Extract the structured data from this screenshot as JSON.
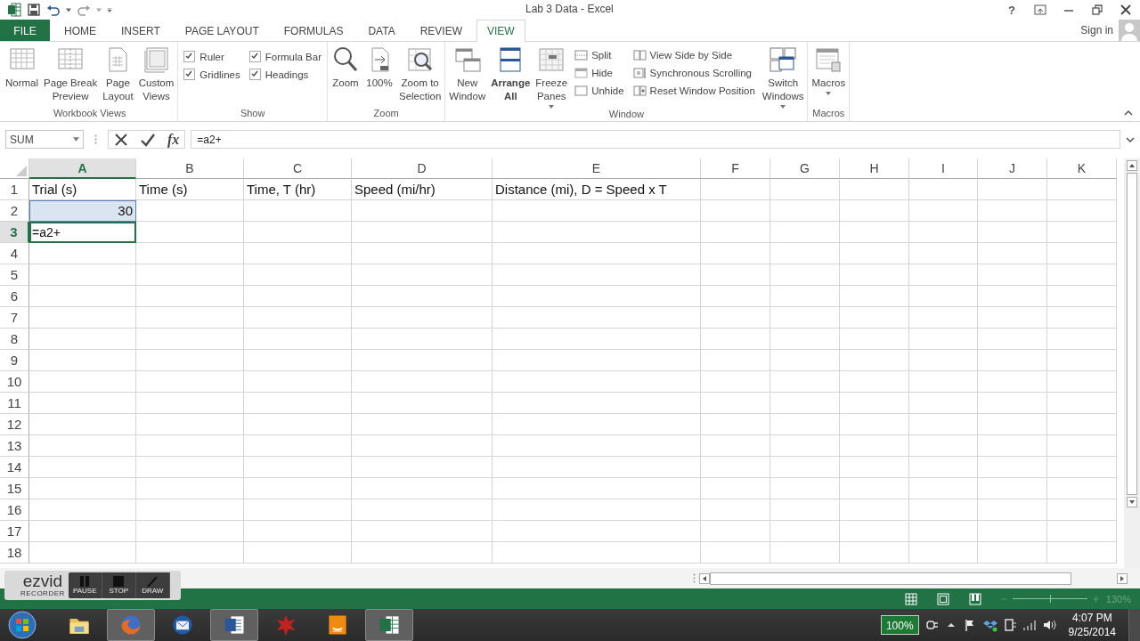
{
  "title_bar": {
    "title": "Lab 3 Data - Excel",
    "help": "?"
  },
  "tabs": [
    {
      "label": "FILE",
      "kind": "file",
      "selected": false
    },
    {
      "label": "HOME",
      "kind": "tab",
      "selected": false
    },
    {
      "label": "INSERT",
      "kind": "tab",
      "selected": false
    },
    {
      "label": "PAGE LAYOUT",
      "kind": "tab",
      "selected": false
    },
    {
      "label": "FORMULAS",
      "kind": "tab",
      "selected": false
    },
    {
      "label": "DATA",
      "kind": "tab",
      "selected": false
    },
    {
      "label": "REVIEW",
      "kind": "tab",
      "selected": false
    },
    {
      "label": "VIEW",
      "kind": "tab",
      "selected": true
    }
  ],
  "account": {
    "label": "Sign in"
  },
  "ribbon": {
    "groups": [
      {
        "label": "Workbook Views",
        "items": [
          {
            "kind": "large",
            "label": "Normal"
          },
          {
            "kind": "large",
            "label": "Page Break\nPreview"
          },
          {
            "kind": "large",
            "label": "Page\nLayout"
          },
          {
            "kind": "large",
            "label": "Custom\nViews"
          }
        ]
      },
      {
        "label": "Show",
        "items": [
          {
            "kind": "stack",
            "items": [
              {
                "kind": "check",
                "label": "Ruler",
                "checked": true
              },
              {
                "kind": "check",
                "label": "Gridlines",
                "checked": true
              }
            ]
          },
          {
            "kind": "stack",
            "items": [
              {
                "kind": "check",
                "label": "Formula Bar",
                "checked": true
              },
              {
                "kind": "check",
                "label": "Headings",
                "checked": true
              }
            ]
          }
        ]
      },
      {
        "label": "Zoom",
        "items": [
          {
            "kind": "large",
            "label": "Zoom"
          },
          {
            "kind": "large",
            "label": "100%"
          },
          {
            "kind": "large",
            "label": "Zoom to\nSelection"
          }
        ]
      },
      {
        "label": "Window",
        "items": [
          {
            "kind": "large",
            "label": "New\nWindow"
          },
          {
            "kind": "large",
            "label": "Arrange\nAll",
            "bold": true
          },
          {
            "kind": "large",
            "label": "Freeze\nPanes",
            "dropdown": true
          },
          {
            "kind": "stack",
            "items": [
              {
                "kind": "small",
                "label": "Split"
              },
              {
                "kind": "small",
                "label": "Hide"
              },
              {
                "kind": "small",
                "label": "Unhide"
              }
            ]
          },
          {
            "kind": "stack",
            "items": [
              {
                "kind": "small",
                "label": "View Side by Side"
              },
              {
                "kind": "small",
                "label": "Synchronous Scrolling"
              },
              {
                "kind": "small",
                "label": "Reset Window Position"
              }
            ]
          },
          {
            "kind": "large",
            "label": "Switch\nWindows",
            "dropdown": true
          }
        ]
      },
      {
        "label": "Macros",
        "items": [
          {
            "kind": "large",
            "label": "Macros",
            "dropdown": true
          }
        ]
      }
    ]
  },
  "formula_bar": {
    "name_box": "SUM",
    "function_label": "fx",
    "formula": "=a2+"
  },
  "sheet": {
    "columns": [
      {
        "label": "A",
        "selected": true
      },
      {
        "label": "B",
        "selected": false
      },
      {
        "label": "C",
        "selected": false
      },
      {
        "label": "D",
        "selected": false
      },
      {
        "label": "E",
        "selected": false
      },
      {
        "label": "F",
        "selected": false
      },
      {
        "label": "G",
        "selected": false
      },
      {
        "label": "H",
        "selected": false
      },
      {
        "label": "I",
        "selected": false
      },
      {
        "label": "J",
        "selected": false
      },
      {
        "label": "K",
        "selected": false
      }
    ],
    "rows": [
      {
        "label": "1",
        "selected": false,
        "cells": [
          {
            "text": "Trial (s)",
            "kind": "text"
          },
          {
            "text": "Time (s)",
            "kind": "text"
          },
          {
            "text": "Time, T (hr)",
            "kind": "text"
          },
          {
            "text": "Speed (mi/hr)",
            "kind": "text"
          },
          {
            "text": "Distance (mi), D = Speed x T",
            "kind": "text"
          }
        ]
      },
      {
        "label": "2",
        "selected": false,
        "cells": [
          {
            "text": "30",
            "kind": "reference"
          }
        ]
      },
      {
        "label": "3",
        "selected": true,
        "cells": [
          {
            "text": "=a2+",
            "kind": "editing"
          }
        ]
      },
      {
        "label": "4",
        "selected": false
      },
      {
        "label": "5",
        "selected": false
      },
      {
        "label": "6",
        "selected": false
      },
      {
        "label": "7",
        "selected": false
      },
      {
        "label": "8",
        "selected": false
      },
      {
        "label": "9",
        "selected": false
      },
      {
        "label": "10",
        "selected": false
      },
      {
        "label": "11",
        "selected": false
      },
      {
        "label": "12",
        "selected": false
      },
      {
        "label": "13",
        "selected": false
      },
      {
        "label": "14",
        "selected": false
      },
      {
        "label": "15",
        "selected": false
      },
      {
        "label": "16",
        "selected": false
      },
      {
        "label": "17",
        "selected": false
      },
      {
        "label": "18",
        "selected": false
      }
    ]
  },
  "recorder": {
    "brand": "ezvid",
    "subtitle": "RECORDER",
    "buttons": [
      "PAUSE",
      "STOP",
      "DRAW"
    ]
  },
  "status_bar": {
    "zoom": {
      "level": 0.5,
      "reading": "130%"
    }
  },
  "taskbar": {
    "apps": [
      {
        "open": false
      },
      {
        "open": true
      },
      {
        "open": false
      },
      {
        "open": true
      },
      {
        "open": false
      },
      {
        "open": false
      },
      {
        "open": true
      }
    ],
    "battery": "100%",
    "time": "4:07 PM",
    "date": "9/25/2014"
  }
}
